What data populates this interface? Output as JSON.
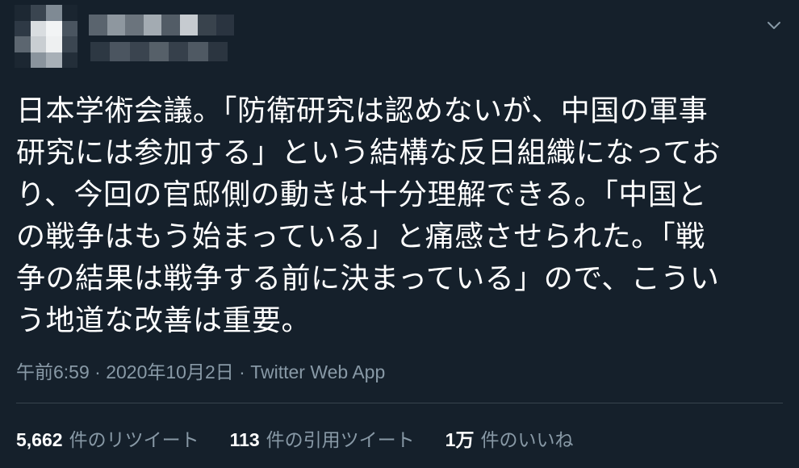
{
  "header": {
    "menu_icon": "chevron-down-icon"
  },
  "tweet": {
    "lines": [
      "日本学術会議。「防衛研究は認めないが、中国の軍事",
      "研究には参加する」という結構な反日組織になってお",
      "り、今回の官邸側の動きは十分理解できる。「中国と",
      "の戦争はもう始まっている」と痛感させられた。「戦",
      "争の結果は戦争する前に決まっている」ので、こうい",
      "う地道な改善は重要。"
    ]
  },
  "meta": {
    "time": "午前6:59",
    "separator1": " · ",
    "date": "2020年10月2日",
    "separator2": " · ",
    "source": "Twitter Web App"
  },
  "stats": {
    "retweets_count": "5,662",
    "retweets_label": "件のリツイート",
    "quotes_count": "113",
    "quotes_label": "件の引用ツイート",
    "likes_count": "1万",
    "likes_label": "件のいいね"
  },
  "colors": {
    "background": "#15202b",
    "text": "#ffffff",
    "secondary": "#8899a6",
    "divider": "#38444d"
  }
}
